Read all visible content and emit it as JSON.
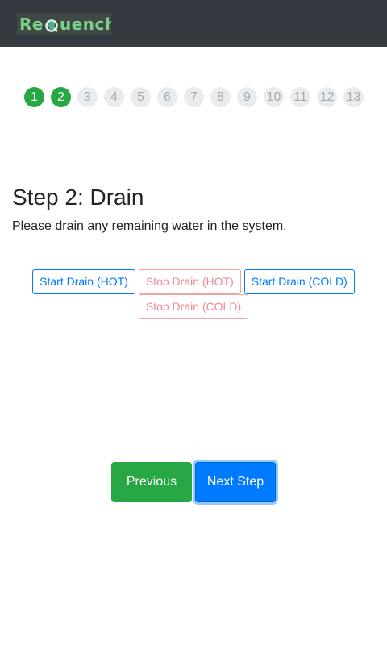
{
  "header": {
    "logo_text_left": "Re",
    "logo_text_right": "uench",
    "logo_mark": "Q"
  },
  "stepper": {
    "current": 2,
    "steps": [
      "1",
      "2",
      "3",
      "4",
      "5",
      "6",
      "7",
      "8",
      "9",
      "10",
      "11",
      "12",
      "13"
    ]
  },
  "content": {
    "title": "Step 2: Drain",
    "description": "Please drain any remaining water in the system."
  },
  "actions": {
    "start_hot": "Start Drain (HOT)",
    "stop_hot": "Stop Drain (HOT)",
    "start_cold": "Start Drain (COLD)",
    "stop_cold": "Stop Drain (COLD)"
  },
  "nav": {
    "previous": "Previous",
    "next": "Next Step"
  },
  "colors": {
    "topbar": "#343a40",
    "success": "#28a745",
    "primary": "#007bff",
    "danger_outline": "#f08a93",
    "step_inactive": "#e9ecef"
  }
}
